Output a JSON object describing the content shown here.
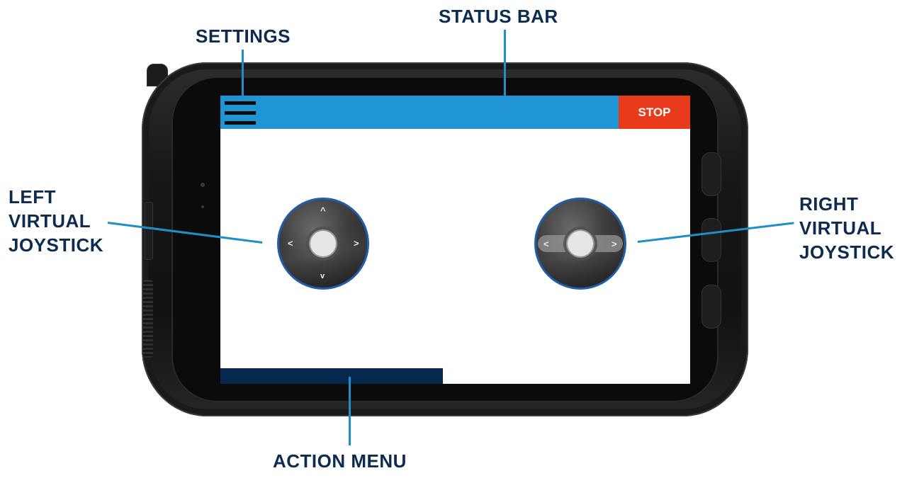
{
  "labels": {
    "status_bar": "STATUS BAR",
    "settings": "SETTINGS",
    "left_joystick": [
      "LEFT",
      "VIRTUAL",
      "JOYSTICK"
    ],
    "right_joystick": [
      "RIGHT",
      "VIRTUAL",
      "JOYSTICK"
    ],
    "action_menu": "ACTION MENU"
  },
  "screen": {
    "stop_label": "STOP",
    "left_joystick_arrows": {
      "up": "^",
      "down": "v",
      "left": "<",
      "right": ">"
    },
    "right_joystick_arrows": {
      "left": "<",
      "right": ">"
    }
  },
  "icons": {
    "settings": "hamburger-menu-icon",
    "joystick_arrows": "chevron-icons"
  },
  "colors": {
    "label_text": "#0d2a4f",
    "leader_line": "#1f8fc6",
    "status_bar": "#1f95d4",
    "stop_button": "#ea3a1c",
    "action_menu": "#06274d",
    "joystick_border": "#1f5ea8"
  }
}
